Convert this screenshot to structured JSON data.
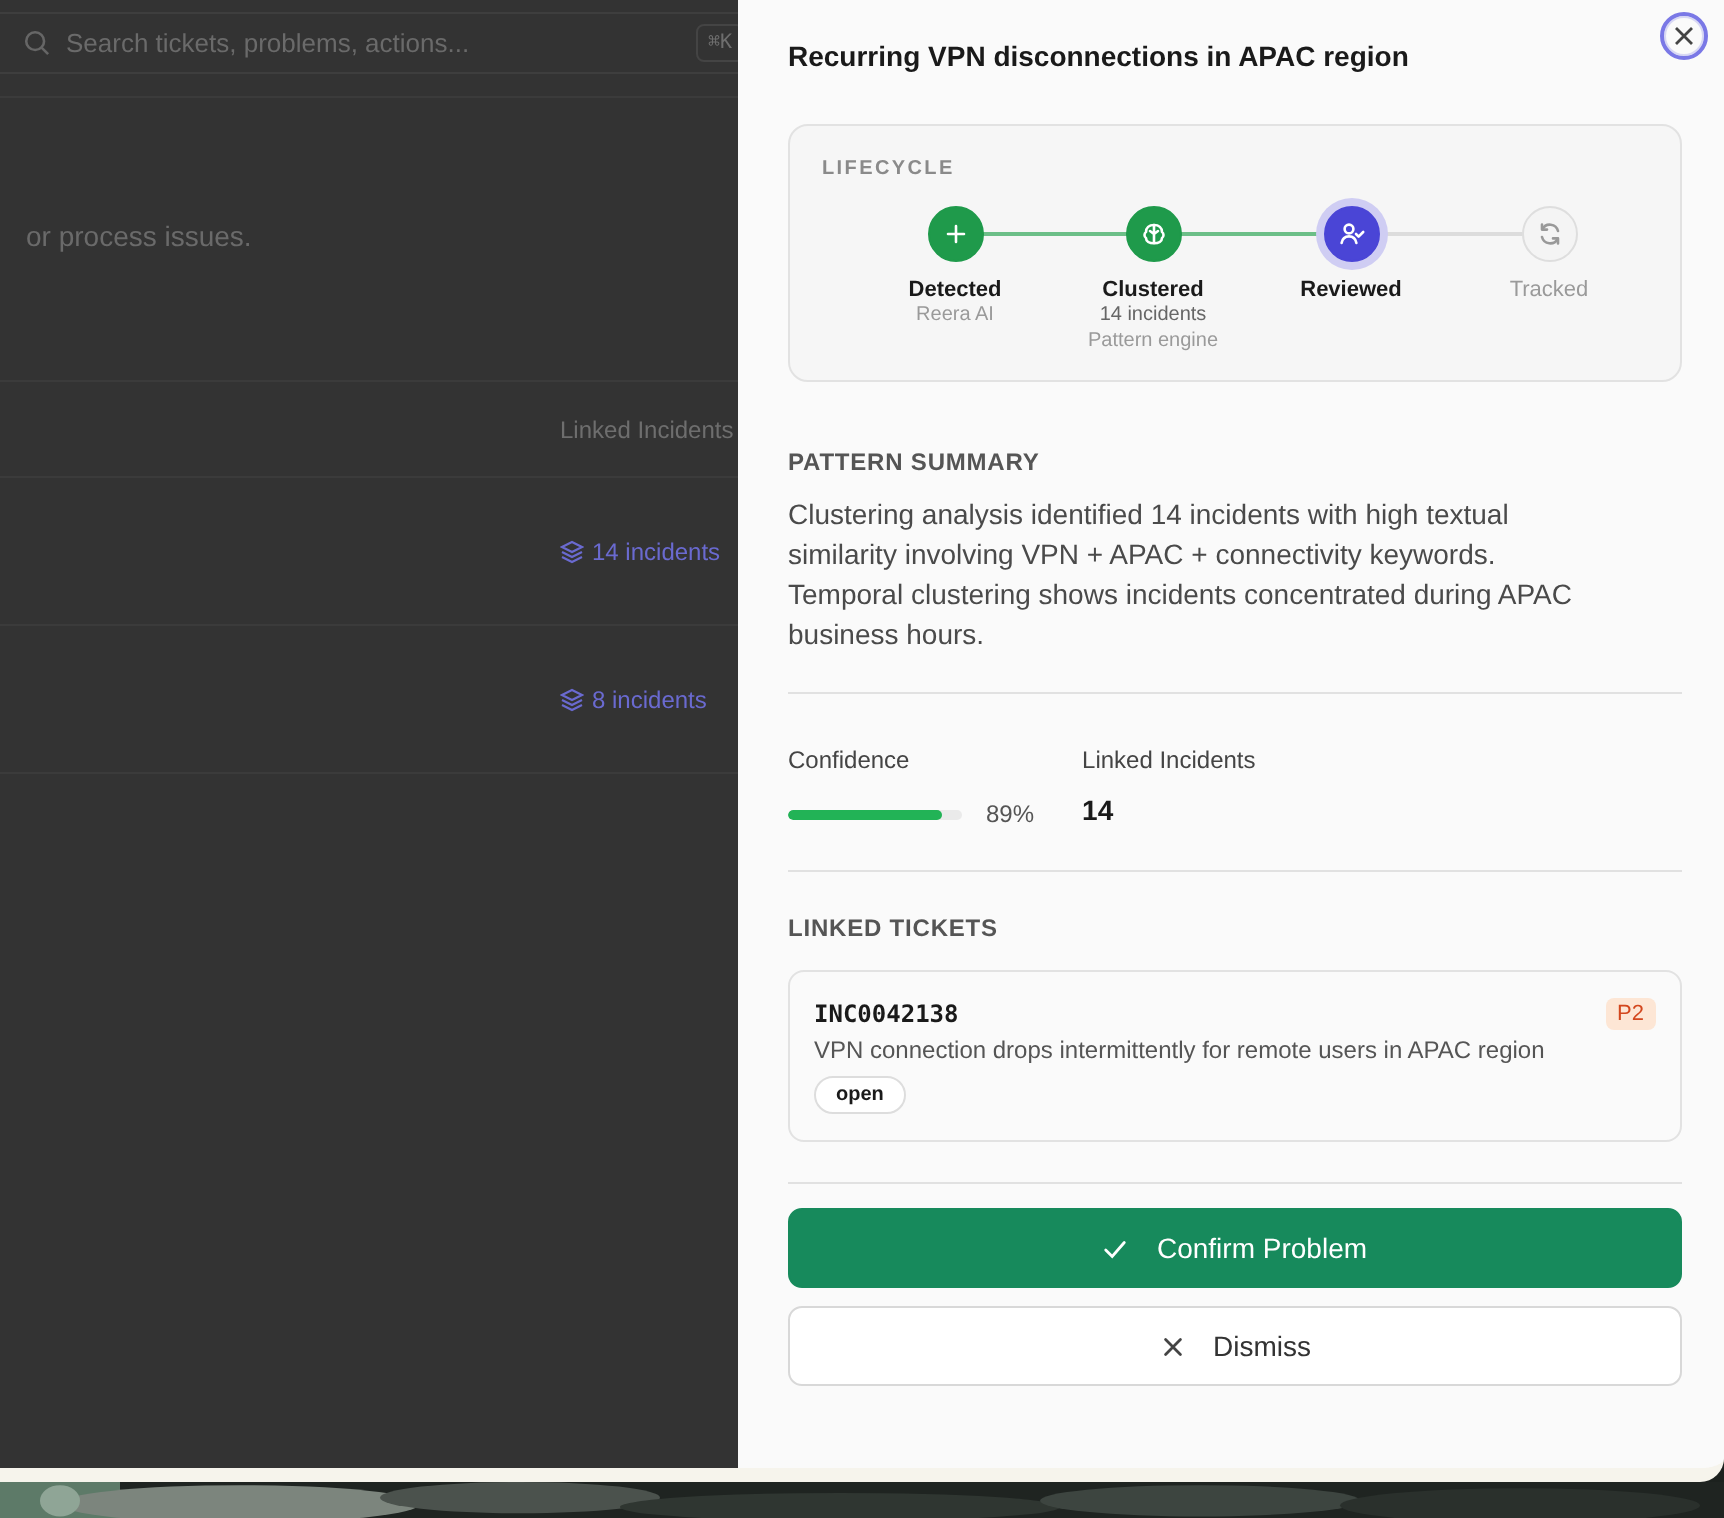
{
  "background": {
    "search": {
      "placeholder": "Search tickets, problems, actions...",
      "shortcut": "⌘K"
    },
    "description": "or process issues.",
    "table": {
      "column_header": "Linked Incidents",
      "rows": [
        {
          "linked": "14 incidents"
        },
        {
          "linked": "8 incidents"
        }
      ]
    }
  },
  "panel": {
    "title": "Recurring VPN disconnections in APAC region",
    "lifecycle": {
      "heading": "LIFECYCLE",
      "stages": [
        {
          "label": "Detected",
          "details": [
            "Reera AI"
          ],
          "completed": true,
          "current": false
        },
        {
          "label": "Clustered",
          "details": [
            "14 incidents",
            "Pattern engine"
          ],
          "completed": true,
          "current": false
        },
        {
          "label": "Reviewed",
          "completed": false,
          "current": true
        },
        {
          "label": "Tracked",
          "completed": false,
          "current": false
        }
      ]
    },
    "summary": {
      "heading": "PATTERN SUMMARY",
      "text": "Clustering analysis identified 14 incidents with high textual similarity involving VPN + APAC + connectivity keywords. Temporal clustering shows incidents concentrated during APAC business hours."
    },
    "metrics": {
      "confidence": {
        "label": "Confidence",
        "level": 0.89,
        "reading": "89%"
      },
      "linked": {
        "label": "Linked Incidents",
        "value": "14"
      }
    },
    "linked_tickets": {
      "heading": "LINKED TICKETS",
      "tickets": [
        {
          "id": "INC0042138",
          "priority": "P2",
          "description": "VPN connection drops intermittently for remote users in APAC region",
          "status": "open"
        }
      ]
    },
    "buttons": [
      {
        "label": "Confirm Problem",
        "kind": "primary"
      },
      {
        "label": "Dismiss",
        "kind": "secondary"
      }
    ]
  }
}
